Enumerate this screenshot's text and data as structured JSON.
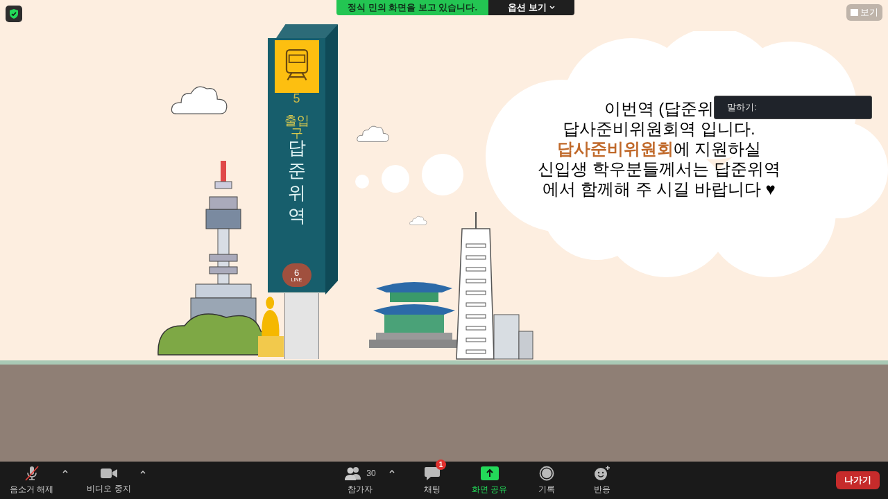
{
  "share_banner": {
    "text": "정식 민의 화면을 보고 있습니다.",
    "options_button": "옵션 보기"
  },
  "view_button": "보기",
  "slide": {
    "sign": {
      "number": "5",
      "exit": "출입구",
      "name": "답준위역",
      "line_number": "6",
      "line_label": "LINE"
    },
    "message": [
      [
        {
          "text": "이번역 (답준위",
          "highlight": false
        }
      ],
      [
        {
          "text": "답사준비위원회역 입니다.",
          "highlight": false
        }
      ],
      [
        {
          "text": "답사준비위원회",
          "highlight": true
        },
        {
          "text": "에 지원하실",
          "highlight": false
        }
      ],
      [
        {
          "text": "신입생 학우분들께서는 답준위역",
          "highlight": false
        }
      ],
      [
        {
          "text": "에서 함께해 주 시길 바랍니다 ♥",
          "highlight": false
        }
      ]
    ]
  },
  "speak_popup": {
    "label": "말하기:"
  },
  "toolbar": {
    "left": [
      {
        "kind": "mic",
        "label": "음소거 해제",
        "muted": true
      },
      {
        "kind": "video",
        "label": "비디오 중지",
        "muted": false
      }
    ],
    "center": [
      {
        "kind": "participants",
        "label": "참가자",
        "count": "30",
        "active": false
      },
      {
        "kind": "chat",
        "label": "채팅",
        "badge": "1",
        "active": false
      },
      {
        "kind": "share",
        "label": "화면 공유",
        "active": true
      },
      {
        "kind": "record",
        "label": "기록",
        "active": false
      },
      {
        "kind": "reactions",
        "label": "반응",
        "active": false
      }
    ],
    "leave_button": "나가기"
  }
}
